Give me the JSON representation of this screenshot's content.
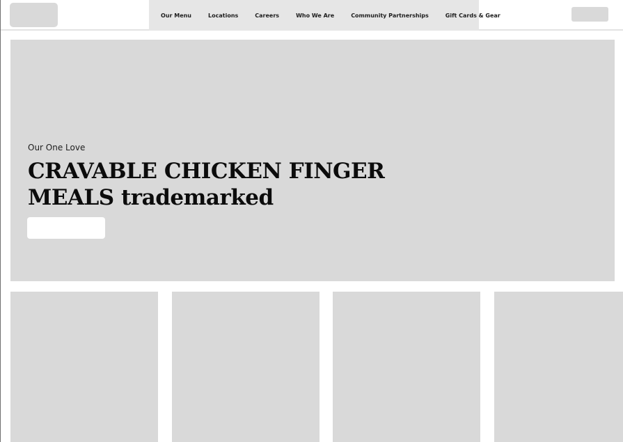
{
  "nav": {
    "items": [
      {
        "label": "Our Menu"
      },
      {
        "label": "Locations"
      },
      {
        "label": "Careers"
      },
      {
        "label": "Who We Are"
      },
      {
        "label": "Community Partnerships"
      },
      {
        "label": "Gift Cards & Gear"
      }
    ]
  },
  "hero": {
    "eyebrow": "Our One Love",
    "headline": "CRAVABLE CHICKEN FINGER MEALS trademarked"
  },
  "colors": {
    "placeholder": "#d9d9d9",
    "nav_background": "#e6e6e6",
    "text": "#0c0c0c"
  }
}
